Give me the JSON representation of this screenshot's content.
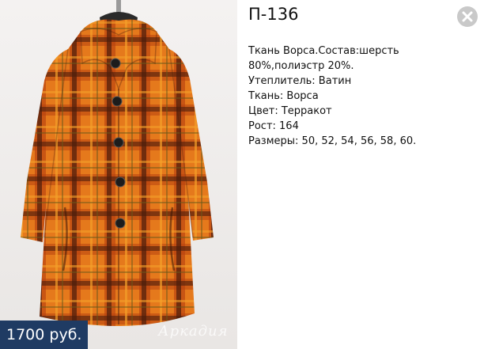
{
  "product": {
    "title": "П-136",
    "price": "1700 руб.",
    "watermark": "Аркадия",
    "details": [
      "Ткань Ворса.Состав:шерсть 80%,полиэстр 20%.",
      "Утеплитель: Ватин",
      "Ткань: Ворса",
      "Цвет: Терракот",
      "Рост: 164",
      "Размеры: 50, 52, 54, 56, 58, 60."
    ]
  },
  "colors": {
    "price_bg": "#1f3b63",
    "coat_orange": "#e0731b",
    "coat_dark": "#6b2a12",
    "close_bg": "#c9c9c9"
  },
  "icons": {
    "close": "close-x-icon"
  }
}
